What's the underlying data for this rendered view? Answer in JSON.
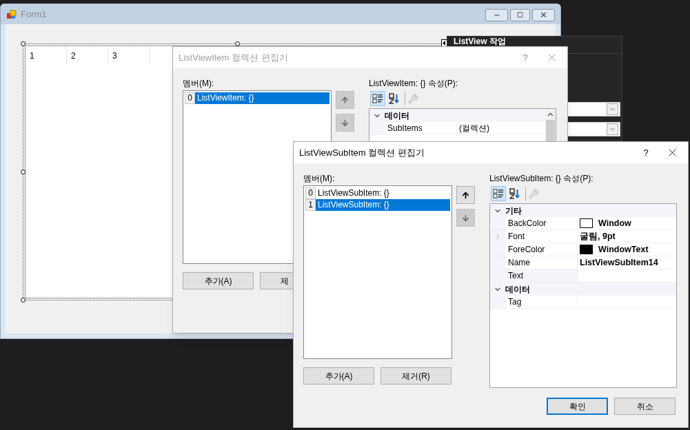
{
  "form": {
    "title": "Form1",
    "active": false,
    "listview": {
      "columns": [
        "1",
        "2",
        "3"
      ]
    },
    "smart_tag_panel": {
      "title": "ListView 작업"
    }
  },
  "item_editor": {
    "title": "ListViewItem 컬렉션 편집기",
    "active": false,
    "help": "?",
    "members_label": "멤버(M):",
    "members": [
      {
        "index": "0",
        "label": "ListViewItem: {}",
        "selected": true
      }
    ],
    "move_up": {
      "disabled": true
    },
    "move_down": {
      "disabled": true
    },
    "add_button": "추가(A)",
    "remove_button": "제",
    "properties_label": "ListViewItem: {} 속성(P):",
    "view_buttons": [
      {
        "kind": "categorized",
        "selected": true
      },
      {
        "kind": "alphabetical",
        "selected": false
      }
    ],
    "categories": [
      {
        "name": "데이터",
        "expanded": true,
        "properties": [
          {
            "name": "SubItems",
            "value": "(컬렉션)",
            "bold": false,
            "expandable": false,
            "selected": false
          }
        ]
      }
    ]
  },
  "subitem_editor": {
    "title": "ListViewSubItem 컬렉션 편집기",
    "active": true,
    "help": "?",
    "members_label": "멤버(M):",
    "members": [
      {
        "index": "0",
        "label": "ListViewSubItem: {}",
        "selected": false
      },
      {
        "index": "1",
        "label": "ListViewSubItem: {}",
        "selected": true
      }
    ],
    "move_up": {
      "disabled": false
    },
    "move_down": {
      "disabled": true
    },
    "add_button": "추가(A)",
    "remove_button": "제거(R)",
    "properties_label": "ListViewSubItem: {} 속성(P):",
    "view_buttons": [
      {
        "kind": "categorized",
        "selected": true
      },
      {
        "kind": "alphabetical",
        "selected": false
      }
    ],
    "categories": [
      {
        "name": "기타",
        "expanded": true,
        "properties": [
          {
            "name": "BackColor",
            "value": "Window",
            "color": "#ffffff",
            "bold": true,
            "expandable": false,
            "selected": false
          },
          {
            "name": "Font",
            "value": "굴림, 9pt",
            "bold": true,
            "expandable": true,
            "selected": false
          },
          {
            "name": "ForeColor",
            "value": "WindowText",
            "color": "#000000",
            "bold": true,
            "expandable": false,
            "selected": false
          },
          {
            "name": "Name",
            "value": "ListViewSubItem14",
            "bold": true,
            "expandable": false,
            "selected": false
          },
          {
            "name": "Text",
            "expandable": false,
            "selected": true
          }
        ]
      },
      {
        "name": "데이터",
        "expanded": true,
        "properties": [
          {
            "name": "Tag",
            "expandable": false,
            "selected": false
          }
        ]
      }
    ],
    "ok_button": "확인",
    "cancel_button": "취소"
  }
}
